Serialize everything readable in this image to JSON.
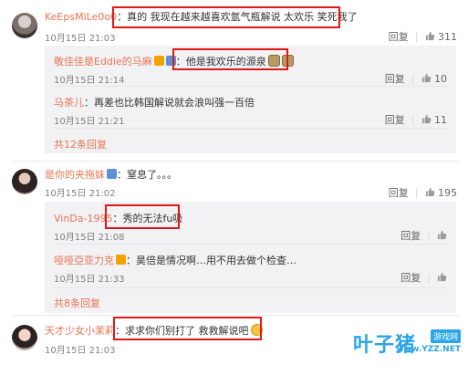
{
  "colors": {
    "username": "#eb7350",
    "highlight_box": "#e01818",
    "reply_bg": "#f2f2f5",
    "watermark": "#2aa5e8"
  },
  "actions": {
    "reply": "回复",
    "like_icon": "thumbs-up-icon"
  },
  "comments": [
    {
      "user": "KeEpsMiLe0o0",
      "text": "真的 我现在越来越喜欢氩气瓶解说 太欢乐 笑死我了",
      "time": "10月15日 21:03",
      "likes": "311",
      "replies": [
        {
          "user": "敬佳佳是Eddie的马麻",
          "text": "他是我欢乐的源泉",
          "time": "10月15日 21:14",
          "likes": "10"
        },
        {
          "user": "马茶儿",
          "text": "再差也比韩国解说就会浪叫强一百倍",
          "time": "10月15日 21:21",
          "likes": "11"
        }
      ],
      "more": "共12条回复"
    },
    {
      "user": "是你的夹拖妹",
      "text": "窒息了。。。",
      "time": "10月15日 21:02",
      "likes": "195",
      "replies": [
        {
          "user": "VinDa-1995",
          "text": "秀的无法fu吸",
          "time": "10月15日 21:08",
          "likes": ""
        },
        {
          "user": "哑哑亞亚力克",
          "text": "昊倍是情况啊…用不用去做个检查…",
          "time": "10月15日 21:33",
          "likes": ""
        }
      ],
      "more": "共8条回复"
    },
    {
      "user": "天才少女小茉莉",
      "text": "求求你们别打了 救救解说吧",
      "time": "10月15日 21:03",
      "likes": "",
      "replies": [],
      "more": ""
    }
  ],
  "watermark": {
    "brand": "叶子猪",
    "tag": "游戏网",
    "url": "www.YZZ.NET"
  }
}
